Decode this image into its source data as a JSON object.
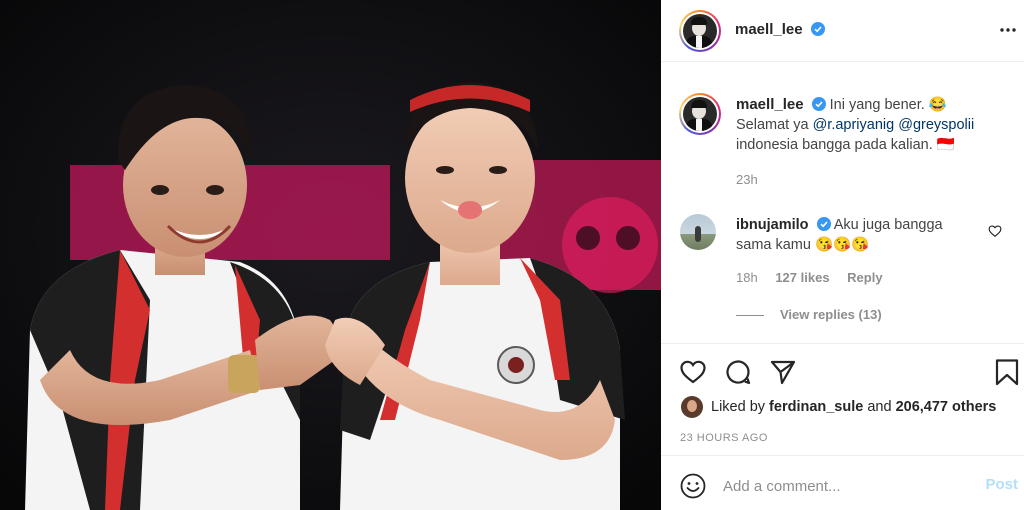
{
  "post": {
    "author": "maell_lee",
    "caption_text": "Ini yang bener. 😂",
    "caption_line2_prefix": "Selamat ya ",
    "mention1": "@r.apriyanig",
    "mention2": "@greyspolii",
    "caption_line3": "indonesia bangga pada kalian. 🇮🇩",
    "time": "23h"
  },
  "comment": {
    "author": "ibnujamilo",
    "text_line1": "Aku juga bangga",
    "text_line2": "sama kamu 😘😘😘",
    "time": "18h",
    "likes": "127 likes",
    "reply": "Reply",
    "view_replies": "View replies (13)"
  },
  "likes": {
    "prefix": "Liked by ",
    "user": "ferdinan_sule",
    "and": " and ",
    "count": "206,477 others"
  },
  "posted_ago": "23 HOURS AGO",
  "add_comment": {
    "placeholder": "Add a comment...",
    "post_label": "Post"
  },
  "colors": {
    "verified": "#3897f0",
    "mention": "#00376b",
    "post_disabled": "#b2dffc",
    "muted": "#8e8e8e"
  },
  "icons": [
    "more-icon",
    "verified-icon",
    "heart-icon",
    "comment-icon",
    "share-icon",
    "bookmark-icon",
    "smile-icon"
  ]
}
